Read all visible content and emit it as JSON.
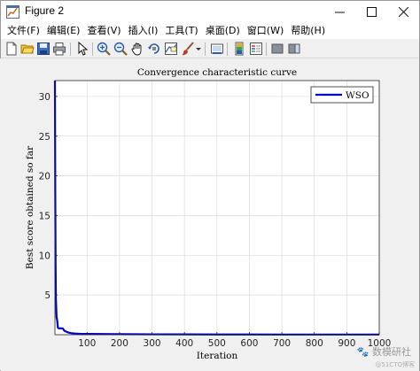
{
  "window": {
    "title": "Figure 2",
    "minimize_glyph": "—",
    "maximize_glyph": "☐",
    "close_glyph": "✕"
  },
  "menu": [
    "文件(F)",
    "编辑(E)",
    "查看(V)",
    "插入(I)",
    "工具(T)",
    "桌面(D)",
    "窗口(W)",
    "帮助(H)"
  ],
  "toolbar_icons": [
    "new-figure-icon",
    "open-file-icon",
    "save-icon",
    "print-icon",
    "pointer-icon",
    "zoom-in-icon",
    "zoom-out-icon",
    "pan-icon",
    "rotate-3d-icon",
    "data-cursor-icon",
    "brush-icon",
    "colorbar-icon",
    "legend-icon",
    "hide-plot-tools-icon",
    "show-plot-tools-icon"
  ],
  "watermark": {
    "text": "🐾 数模研社",
    "subtext": "@51CTO博客"
  },
  "chart_data": {
    "type": "line",
    "title": "Convergence characteristic curve",
    "xlabel": "Iteration",
    "ylabel": "Best score obtained so far",
    "xlim": [
      1,
      1000
    ],
    "ylim": [
      0,
      32
    ],
    "xticks": [
      100,
      200,
      300,
      400,
      500,
      600,
      700,
      800,
      900,
      1000
    ],
    "yticks": [
      5,
      10,
      15,
      20,
      25,
      30
    ],
    "grid": true,
    "legend_position": "top-right",
    "series": [
      {
        "name": "WSO",
        "color": "#0000cc",
        "x": [
          1,
          2,
          3,
          4,
          5,
          6,
          8,
          10,
          12,
          15,
          20,
          25,
          30,
          40,
          50,
          60,
          80,
          100,
          150,
          200,
          300,
          400,
          500,
          600,
          700,
          800,
          900,
          1000
        ],
        "y": [
          32,
          18,
          9,
          4.5,
          3.3,
          2.2,
          1.8,
          0.9,
          0.8,
          0.8,
          0.8,
          0.8,
          0.5,
          0.3,
          0.2,
          0.15,
          0.1,
          0.1,
          0.08,
          0.07,
          0.05,
          0.04,
          0.03,
          0.03,
          0.02,
          0.02,
          0.02,
          0.02
        ]
      }
    ]
  }
}
